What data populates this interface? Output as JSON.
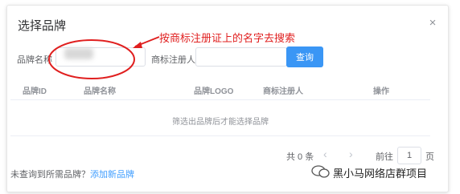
{
  "dialog": {
    "title": "选择品牌",
    "close_symbol": "×"
  },
  "annotation": {
    "text": "按商标注册证上的名字去搜索",
    "color": "#e01f1f"
  },
  "search": {
    "brand_name_label": "品牌名称",
    "brand_name_value": "",
    "registrant_label": "商标注册人",
    "registrant_value": "",
    "search_button": "查询"
  },
  "table": {
    "columns": [
      "品牌ID",
      "品牌名称",
      "品牌LOGO",
      "商标注册人",
      "操作"
    ],
    "empty_text": "筛选出品牌后才能选择品牌"
  },
  "pagination": {
    "total_text": "共 0 条",
    "prev_symbol": "‹",
    "next_symbol": "›",
    "goto_label": "前往",
    "current_page": "1",
    "page_unit": "页"
  },
  "footer": {
    "question": "未查询到所需品牌？",
    "add_link": "添加新品牌"
  },
  "watermark": {
    "text": "黑小马网络店群项目"
  },
  "colors": {
    "primary": "#3a96f5",
    "link": "#409eff",
    "annotation_red": "#e01f1f"
  }
}
